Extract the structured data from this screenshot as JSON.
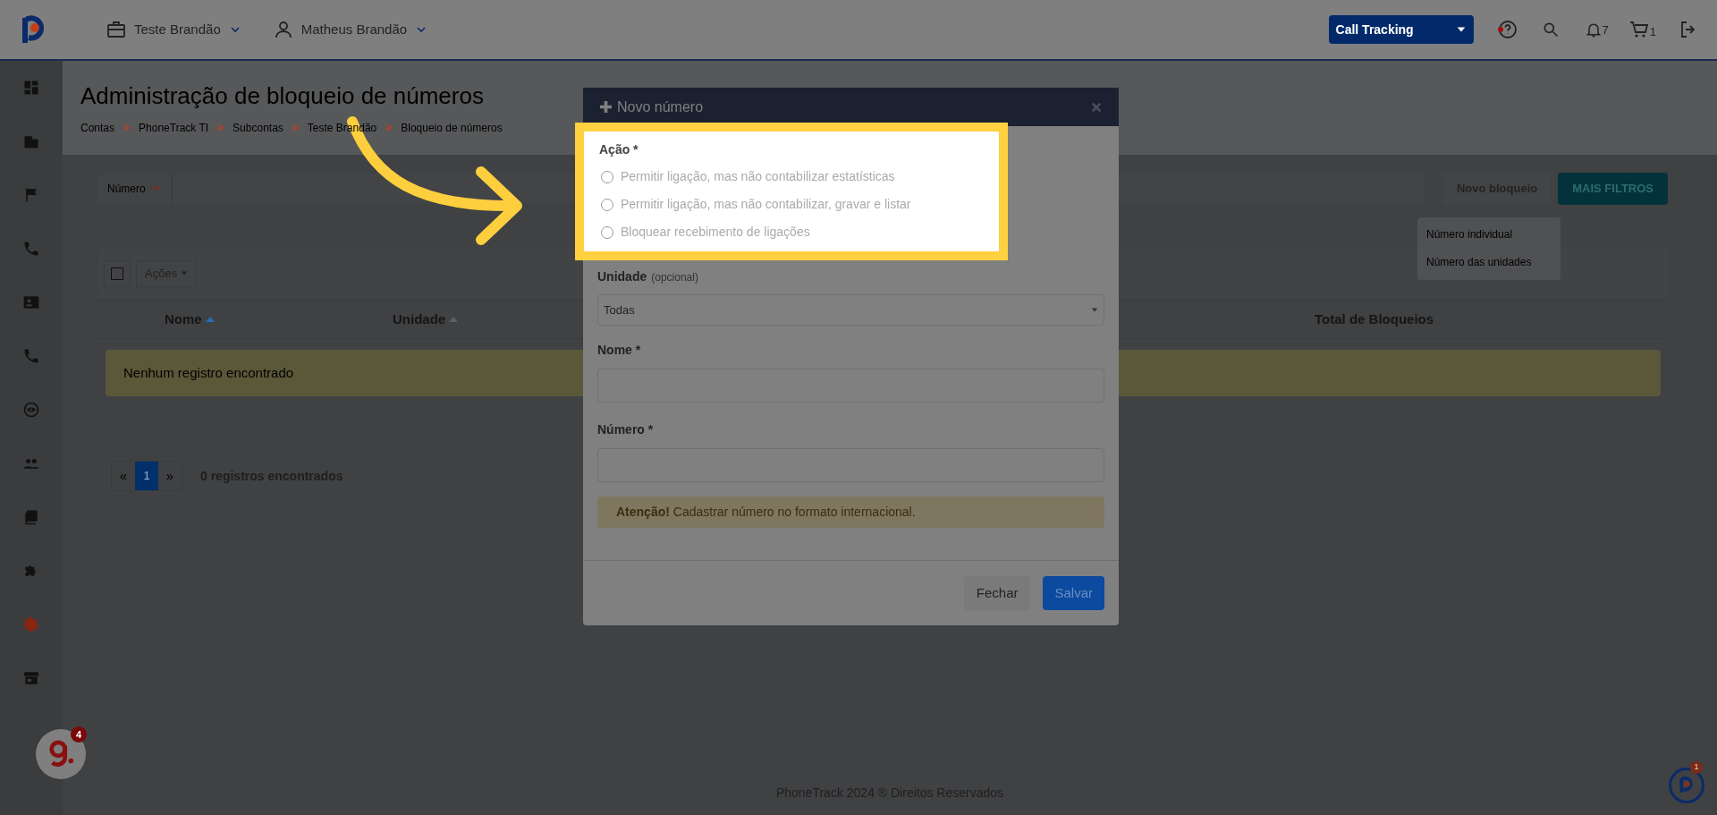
{
  "topbar": {
    "account": "Teste Brandão",
    "user": "Matheus Brandão",
    "product_select": "Call Tracking",
    "notifications_count": "7",
    "cart_count": "1"
  },
  "sidebar": {
    "items": [
      {
        "kind": "dashboard",
        "selected": false
      },
      {
        "kind": "building",
        "selected": false
      },
      {
        "kind": "flag",
        "selected": false
      },
      {
        "kind": "phone",
        "selected": false
      },
      {
        "kind": "contact",
        "selected": false
      },
      {
        "kind": "phone",
        "selected": false
      },
      {
        "kind": "eye",
        "selected": false
      },
      {
        "kind": "people",
        "selected": false
      },
      {
        "kind": "book",
        "selected": false
      },
      {
        "kind": "puzzle",
        "selected": false
      },
      {
        "kind": "gear",
        "selected": true
      },
      {
        "kind": "store",
        "selected": false
      }
    ]
  },
  "page": {
    "title": "Administração de bloqueio de números",
    "breadcrumb": [
      {
        "label": "Contas"
      },
      {
        "separator": ">",
        "label": "PhoneTrack TI"
      },
      {
        "separator": ">",
        "label": "Subcontas"
      },
      {
        "separator": ">",
        "label": "Teste Brandão"
      },
      {
        "separator": ">",
        "label": "Bloqueio de números"
      }
    ],
    "filter": {
      "field": "Número"
    },
    "buttons": [
      "Novo bloqueio",
      "MAIS FILTROS"
    ],
    "dropdown": [
      "Número individual",
      "Número das unidades"
    ],
    "select_all": {
      "checked": false
    },
    "actions_button": "Ações",
    "columns": [
      {
        "label": "Nome",
        "sorted": true
      },
      {
        "label": "Unidade",
        "sorted": false
      },
      {
        "label": "Total de Bloqueios"
      }
    ],
    "empty_message": "Nenhum registro encontrado",
    "pagination": {
      "prev": "«",
      "pages": [
        {
          "label": "1",
          "selected": true
        }
      ],
      "next": "»",
      "count": "0 registros encontrados"
    }
  },
  "modal": {
    "title": "Novo número",
    "action": {
      "label": "Ação *",
      "options": [
        {
          "label": "Permitir ligação, mas não contabilizar estatísticas",
          "selected": false
        },
        {
          "label": "Permitir ligação, mas não contabilizar, gravar e listar",
          "selected": false
        },
        {
          "label": "Bloquear recebimento de ligações",
          "selected": false
        }
      ]
    },
    "unit": {
      "label": "Unidade",
      "hint": "(opcional)",
      "value": "Todas"
    },
    "name": {
      "label": "Nome *"
    },
    "number": {
      "label": "Número *"
    },
    "alert": "**Atenção!** Cadastrar número no formato internacional.",
    "buttons": [
      "Fechar",
      "Salvar"
    ]
  },
  "footer": "PhoneTrack 2024 ® Direitos Reservados",
  "help_widget": {
    "badge": "4"
  },
  "chat_widget": {
    "badge": "1"
  }
}
